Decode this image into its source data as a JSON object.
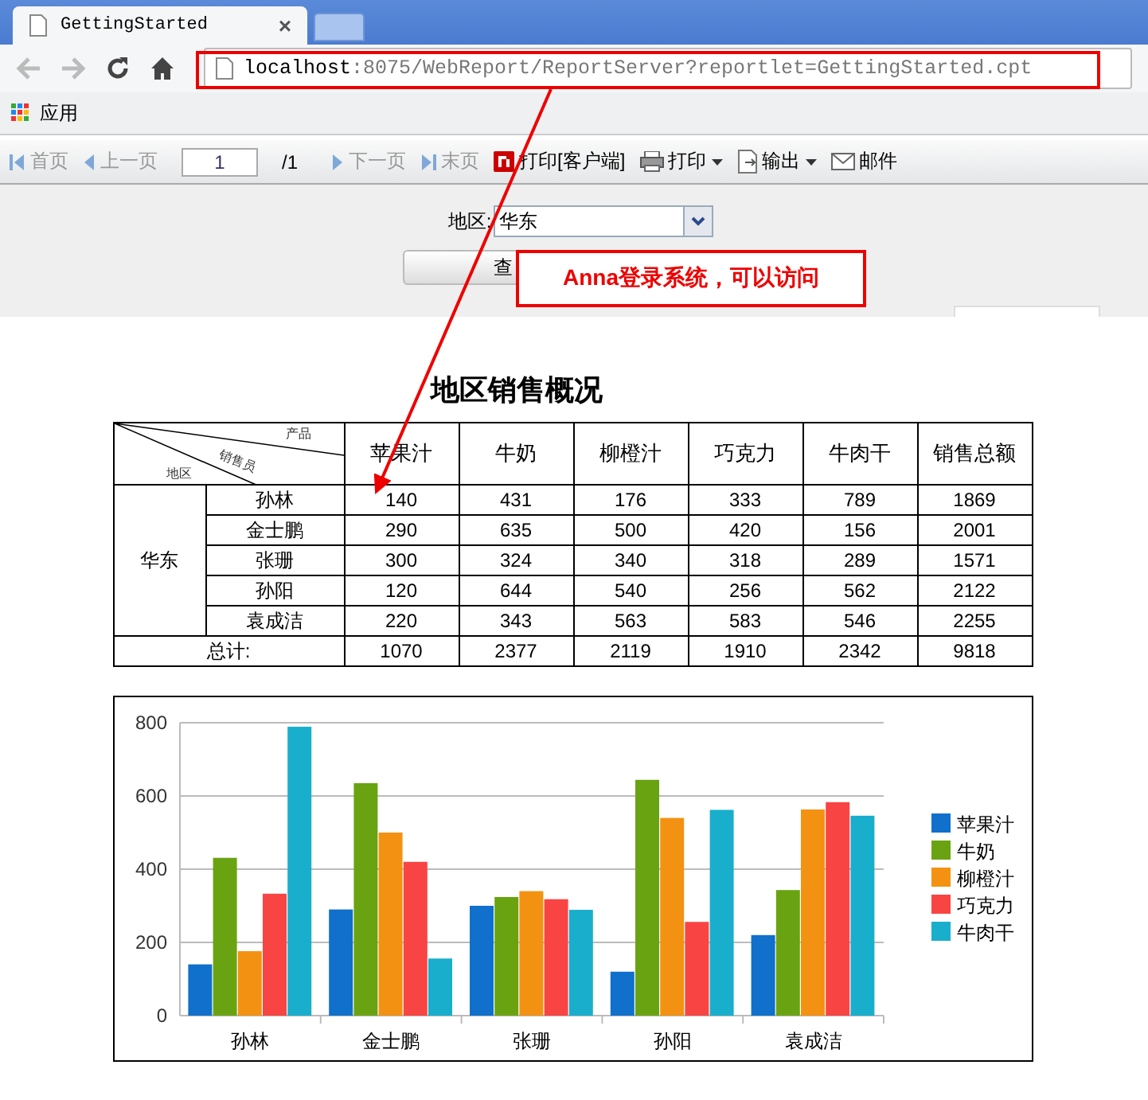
{
  "browser": {
    "tab": {
      "title": "GettingStarted",
      "close": "×"
    },
    "address": {
      "host": "localhost",
      "path": ":8075/WebReport/ReportServer?reportlet=GettingStarted.cpt"
    },
    "bookmarks": [
      {
        "label": "应用"
      }
    ]
  },
  "toolbar": {
    "items": [
      {
        "kind": "nav",
        "label": "首页",
        "disabled": true
      },
      {
        "kind": "nav",
        "label": "上一页",
        "disabled": true
      },
      {
        "kind": "page",
        "value": "1",
        "total": "/1"
      },
      {
        "kind": "nav",
        "label": "下一页",
        "disabled": true
      },
      {
        "kind": "nav",
        "label": "末页",
        "disabled": true
      },
      {
        "kind": "button",
        "label": "打印[客户端]",
        "disabled": false
      },
      {
        "kind": "menu",
        "label": "打印",
        "disabled": false
      },
      {
        "kind": "menu",
        "label": "输出",
        "disabled": false
      },
      {
        "kind": "button",
        "label": "邮件",
        "disabled": false
      }
    ]
  },
  "params": {
    "label": "地区:",
    "value": "华东",
    "query_button": "查"
  },
  "annotation": {
    "text": "Anna登录系统，可以访问"
  },
  "report": {
    "title": "地区销售概况",
    "corner": {
      "top": "产品",
      "middle": "销售员",
      "bottom": "地区"
    },
    "columns": [
      "苹果汁",
      "牛奶",
      "柳橙汁",
      "巧克力",
      "牛肉干",
      "销售总额"
    ],
    "region": "华东",
    "rows": [
      {
        "name": "孙林",
        "values": [
          "140",
          "431",
          "176",
          "333",
          "789",
          "1869"
        ]
      },
      {
        "name": "金士鹏",
        "values": [
          "290",
          "635",
          "500",
          "420",
          "156",
          "2001"
        ]
      },
      {
        "name": "张珊",
        "values": [
          "300",
          "324",
          "340",
          "318",
          "289",
          "1571"
        ]
      },
      {
        "name": "孙阳",
        "values": [
          "120",
          "644",
          "540",
          "256",
          "562",
          "2122"
        ]
      },
      {
        "name": "袁成洁",
        "values": [
          "220",
          "343",
          "563",
          "583",
          "546",
          "2255"
        ]
      }
    ],
    "total": {
      "label": "总计:",
      "values": [
        "1070",
        "2377",
        "2119",
        "1910",
        "2342",
        "9818"
      ]
    },
    "chart_data": {
      "type": "bar",
      "grid": true,
      "legend": true,
      "categories": [
        "孙林",
        "金士鹏",
        "张珊",
        "孙阳",
        "袁成洁"
      ],
      "ylim": [
        0,
        800
      ],
      "yticks": [
        0,
        200,
        400,
        600,
        800
      ],
      "series": [
        {
          "name": "苹果汁",
          "color": "#1070cc",
          "values": [
            140,
            290,
            300,
            120,
            220
          ]
        },
        {
          "name": "牛奶",
          "color": "#6aa312",
          "values": [
            431,
            635,
            324,
            644,
            343
          ]
        },
        {
          "name": "柳橙汁",
          "color": "#f39212",
          "values": [
            176,
            500,
            340,
            540,
            563
          ]
        },
        {
          "name": "巧克力",
          "color": "#f94444",
          "values": [
            333,
            420,
            318,
            256,
            583
          ]
        },
        {
          "name": "牛肉干",
          "color": "#19aecc",
          "values": [
            789,
            156,
            289,
            562,
            546
          ]
        }
      ]
    }
  }
}
